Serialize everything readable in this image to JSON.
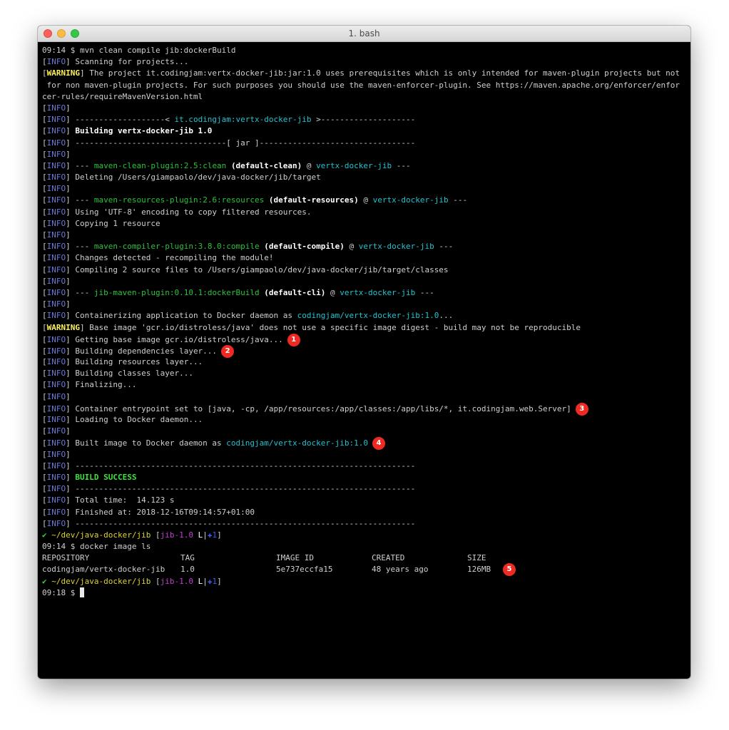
{
  "window": {
    "title": "1. bash"
  },
  "colors": {
    "info": "#6b7bd6",
    "warning": "#fdf35a",
    "cyan": "#22c2cf",
    "plugin_green": "#2dc03c",
    "success": "#3ee23e",
    "marker": "#ee2a22",
    "branch": "#c13fd2",
    "path": "#ddd52e",
    "background": "#000000"
  },
  "terminal": {
    "lines": [
      {
        "type": "plain",
        "text": "09:14 $ mvn clean compile jib:dockerBuild"
      },
      {
        "type": "log",
        "level": "INFO",
        "segments": [
          {
            "text": "Scanning for projects..."
          }
        ]
      },
      {
        "type": "log",
        "level": "WARNING",
        "segments": [
          {
            "text": "The project it.codingjam:vertx-docker-jib:jar:1.0 uses prerequisites which is only intended for maven-plugin projects but not"
          }
        ]
      },
      {
        "type": "plain",
        "text": " for non maven-plugin projects. For such purposes you should use the maven-enforcer-plugin. See https://maven.apache.org/enforcer/enfor"
      },
      {
        "type": "plain",
        "text": "cer-rules/requireMavenVersion.html"
      },
      {
        "type": "log",
        "level": "INFO",
        "segments": []
      },
      {
        "type": "log",
        "level": "INFO",
        "segments": [
          {
            "text": "-------------------< "
          },
          {
            "text": "it.codingjam:vertx-docker-jib",
            "style": "cyan"
          },
          {
            "text": " >--------------------"
          }
        ]
      },
      {
        "type": "log",
        "level": "INFO",
        "segments": [
          {
            "text": "Building vertx-docker-jib 1.0",
            "style": "bold"
          }
        ]
      },
      {
        "type": "log",
        "level": "INFO",
        "segments": [
          {
            "text": "--------------------------------[ jar ]---------------------------------"
          }
        ]
      },
      {
        "type": "log",
        "level": "INFO",
        "segments": []
      },
      {
        "type": "log",
        "level": "INFO",
        "segments": [
          {
            "text": "--- "
          },
          {
            "text": "maven-clean-plugin:2.5:clean",
            "style": "green"
          },
          {
            "text": " "
          },
          {
            "text": "(default-clean)",
            "style": "bold"
          },
          {
            "text": " @ "
          },
          {
            "text": "vertx-docker-jib",
            "style": "cyan"
          },
          {
            "text": " ---"
          }
        ]
      },
      {
        "type": "log",
        "level": "INFO",
        "segments": [
          {
            "text": "Deleting /Users/giampaolo/dev/java-docker/jib/target"
          }
        ]
      },
      {
        "type": "log",
        "level": "INFO",
        "segments": []
      },
      {
        "type": "log",
        "level": "INFO",
        "segments": [
          {
            "text": "--- "
          },
          {
            "text": "maven-resources-plugin:2.6:resources",
            "style": "green"
          },
          {
            "text": " "
          },
          {
            "text": "(default-resources)",
            "style": "bold"
          },
          {
            "text": " @ "
          },
          {
            "text": "vertx-docker-jib",
            "style": "cyan"
          },
          {
            "text": " ---"
          }
        ]
      },
      {
        "type": "log",
        "level": "INFO",
        "segments": [
          {
            "text": "Using 'UTF-8' encoding to copy filtered resources."
          }
        ]
      },
      {
        "type": "log",
        "level": "INFO",
        "segments": [
          {
            "text": "Copying 1 resource"
          }
        ]
      },
      {
        "type": "log",
        "level": "INFO",
        "segments": []
      },
      {
        "type": "log",
        "level": "INFO",
        "segments": [
          {
            "text": "--- "
          },
          {
            "text": "maven-compiler-plugin:3.8.0:compile",
            "style": "green"
          },
          {
            "text": " "
          },
          {
            "text": "(default-compile)",
            "style": "bold"
          },
          {
            "text": " @ "
          },
          {
            "text": "vertx-docker-jib",
            "style": "cyan"
          },
          {
            "text": " ---"
          }
        ]
      },
      {
        "type": "log",
        "level": "INFO",
        "segments": [
          {
            "text": "Changes detected - recompiling the module!"
          }
        ]
      },
      {
        "type": "log",
        "level": "INFO",
        "segments": [
          {
            "text": "Compiling 2 source files to /Users/giampaolo/dev/java-docker/jib/target/classes"
          }
        ]
      },
      {
        "type": "log",
        "level": "INFO",
        "segments": []
      },
      {
        "type": "log",
        "level": "INFO",
        "segments": [
          {
            "text": "--- "
          },
          {
            "text": "jib-maven-plugin:0.10.1:dockerBuild",
            "style": "green"
          },
          {
            "text": " "
          },
          {
            "text": "(default-cli)",
            "style": "bold"
          },
          {
            "text": " @ "
          },
          {
            "text": "vertx-docker-jib",
            "style": "cyan"
          },
          {
            "text": " ---"
          }
        ]
      },
      {
        "type": "log",
        "level": "INFO",
        "segments": []
      },
      {
        "type": "log",
        "level": "INFO",
        "segments": [
          {
            "text": "Containerizing application to Docker daemon as "
          },
          {
            "text": "codingjam/vertx-docker-jib:1.0",
            "style": "cyan"
          },
          {
            "text": "..."
          }
        ]
      },
      {
        "type": "log",
        "level": "WARNING",
        "segments": [
          {
            "text": "Base image 'gcr.io/distroless/java' does not use a specific image digest - build may not be reproducible"
          }
        ]
      },
      {
        "type": "log",
        "level": "INFO",
        "segments": [
          {
            "text": "Getting base image gcr.io/distroless/java..."
          }
        ],
        "marker": "1"
      },
      {
        "type": "log",
        "level": "INFO",
        "segments": [
          {
            "text": "Building dependencies layer..."
          }
        ],
        "marker": "2"
      },
      {
        "type": "log",
        "level": "INFO",
        "segments": [
          {
            "text": "Building resources layer..."
          }
        ]
      },
      {
        "type": "log",
        "level": "INFO",
        "segments": [
          {
            "text": "Building classes layer..."
          }
        ]
      },
      {
        "type": "log",
        "level": "INFO",
        "segments": [
          {
            "text": "Finalizing..."
          }
        ]
      },
      {
        "type": "log",
        "level": "INFO",
        "segments": []
      },
      {
        "type": "log",
        "level": "INFO",
        "segments": [
          {
            "text": "Container entrypoint set to [java, -cp, /app/resources:/app/classes:/app/libs/*, it.codingjam.web.Server]"
          }
        ],
        "marker": "3"
      },
      {
        "type": "log",
        "level": "INFO",
        "segments": [
          {
            "text": "Loading to Docker daemon..."
          }
        ]
      },
      {
        "type": "log",
        "level": "INFO",
        "segments": []
      },
      {
        "type": "log",
        "level": "INFO",
        "segments": [
          {
            "text": "Built image to Docker daemon as "
          },
          {
            "text": "codingjam/vertx-docker-jib:1.0",
            "style": "cyan"
          }
        ],
        "marker": "4"
      },
      {
        "type": "log",
        "level": "INFO",
        "segments": []
      },
      {
        "type": "log",
        "level": "INFO",
        "segments": [
          {
            "text": "------------------------------------------------------------------------"
          }
        ]
      },
      {
        "type": "log",
        "level": "INFO",
        "segments": [
          {
            "text": "BUILD SUCCESS",
            "style": "success"
          }
        ]
      },
      {
        "type": "log",
        "level": "INFO",
        "segments": [
          {
            "text": "------------------------------------------------------------------------"
          }
        ]
      },
      {
        "type": "log",
        "level": "INFO",
        "segments": [
          {
            "text": "Total time:  14.123 s"
          }
        ]
      },
      {
        "type": "log",
        "level": "INFO",
        "segments": [
          {
            "text": "Finished at: 2018-12-16T09:14:57+01:00"
          }
        ]
      },
      {
        "type": "log",
        "level": "INFO",
        "segments": [
          {
            "text": "------------------------------------------------------------------------"
          }
        ]
      },
      {
        "type": "prompt",
        "check": "✔",
        "path": "~/dev/java-docker/jib",
        "branch": "jib-1.0",
        "status_l": "L",
        "status_bar": "|",
        "status_plus": "✚",
        "status_count": "1"
      },
      {
        "type": "plain",
        "text": "09:14 $ docker image ls"
      },
      {
        "type": "table",
        "cells": [
          "REPOSITORY",
          "TAG",
          "IMAGE ID",
          "CREATED",
          "SIZE"
        ]
      },
      {
        "type": "table",
        "cells": [
          "codingjam/vertx-docker-jib",
          "1.0",
          "5e737eccfa15",
          "48 years ago",
          "126MB"
        ],
        "marker": "5"
      },
      {
        "type": "prompt",
        "check": "✔",
        "path": "~/dev/java-docker/jib",
        "branch": "jib-1.0",
        "status_l": "L",
        "status_bar": "|",
        "status_plus": "✚",
        "status_count": "1"
      },
      {
        "type": "cursor",
        "text": "09:18 $ "
      }
    ]
  }
}
